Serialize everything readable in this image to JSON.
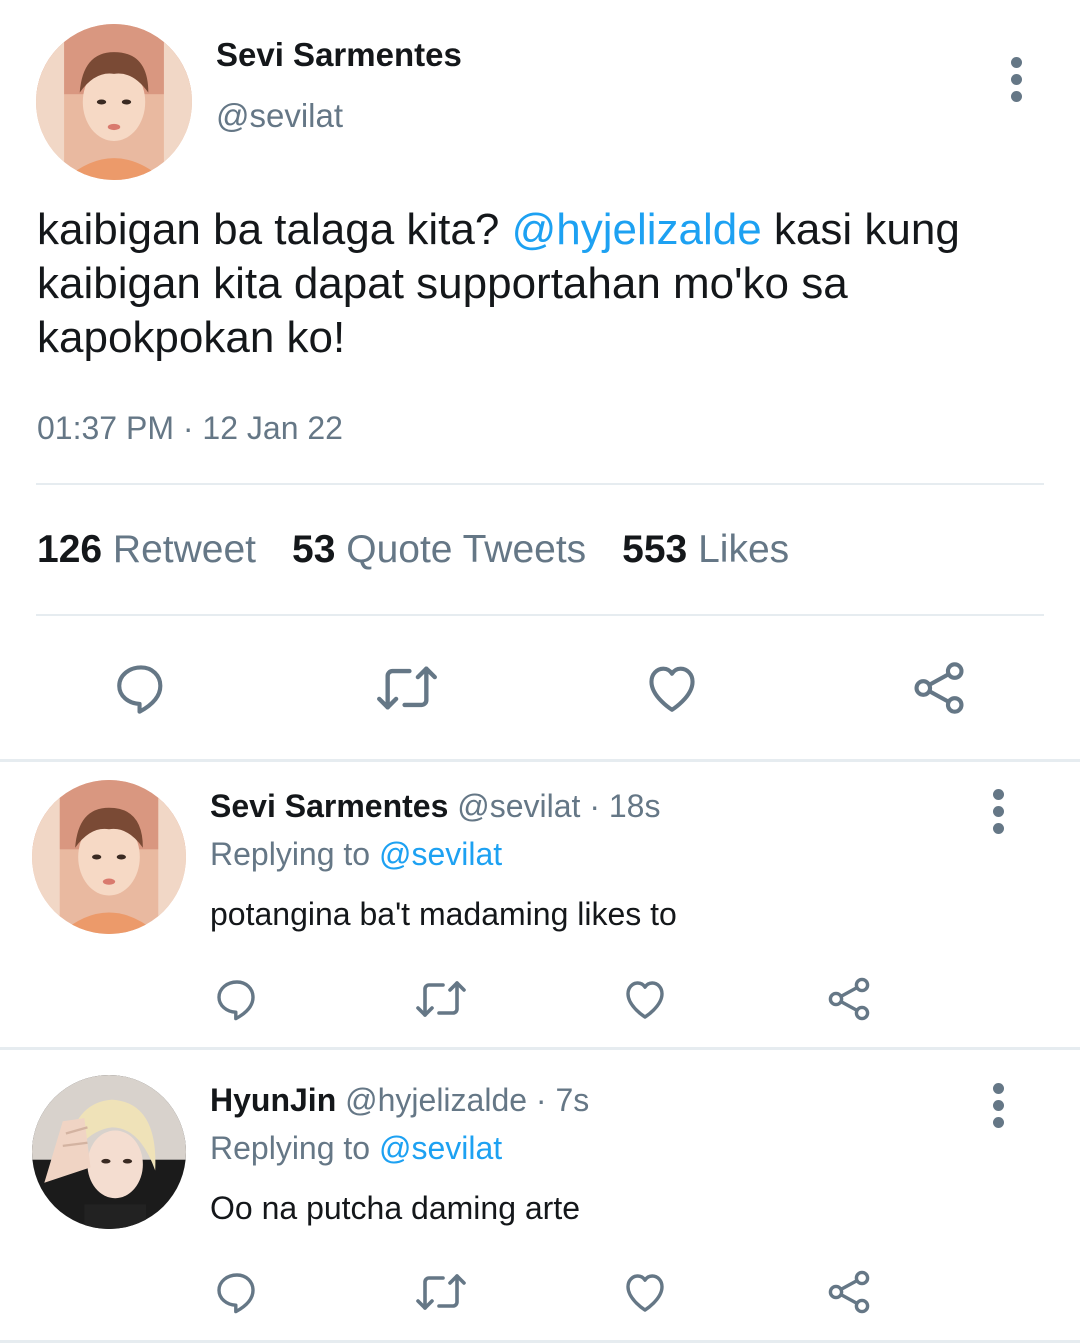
{
  "main_tweet": {
    "author_name": "Sevi Sarmentes",
    "author_handle": "@sevilat",
    "text_before": "kaibigan ba talaga kita? ",
    "mention": "@hyjelizalde",
    "text_after": " kasi kung kaibigan kita dapat supportahan mo'ko sa kapokpokan ko!",
    "timestamp": "01:37 PM · 12 Jan 22",
    "stats": {
      "retweets_count": "126",
      "retweets_label": "Retweet",
      "quotes_count": "53",
      "quotes_label": "Quote Tweets",
      "likes_count": "553",
      "likes_label": "Likes"
    },
    "actions": [
      "reply-icon",
      "retweet-icon",
      "like-icon",
      "share-icon"
    ]
  },
  "replies": [
    {
      "author_name": "Sevi Sarmentes",
      "meta": "@sevilat · 18s",
      "replying_prefix": "Replying to ",
      "replying_handle": "@sevilat",
      "text": "potangina ba't madaming likes to"
    },
    {
      "author_name": "HyunJin",
      "meta": "@hyjelizalde · 7s",
      "replying_prefix": "Replying to ",
      "replying_handle": "@sevilat",
      "text": "Oo na putcha daming arte"
    }
  ],
  "colors": {
    "text": "#14171a",
    "secondary": "#657786",
    "link": "#1da1f2",
    "divider": "#e6ecf0"
  }
}
